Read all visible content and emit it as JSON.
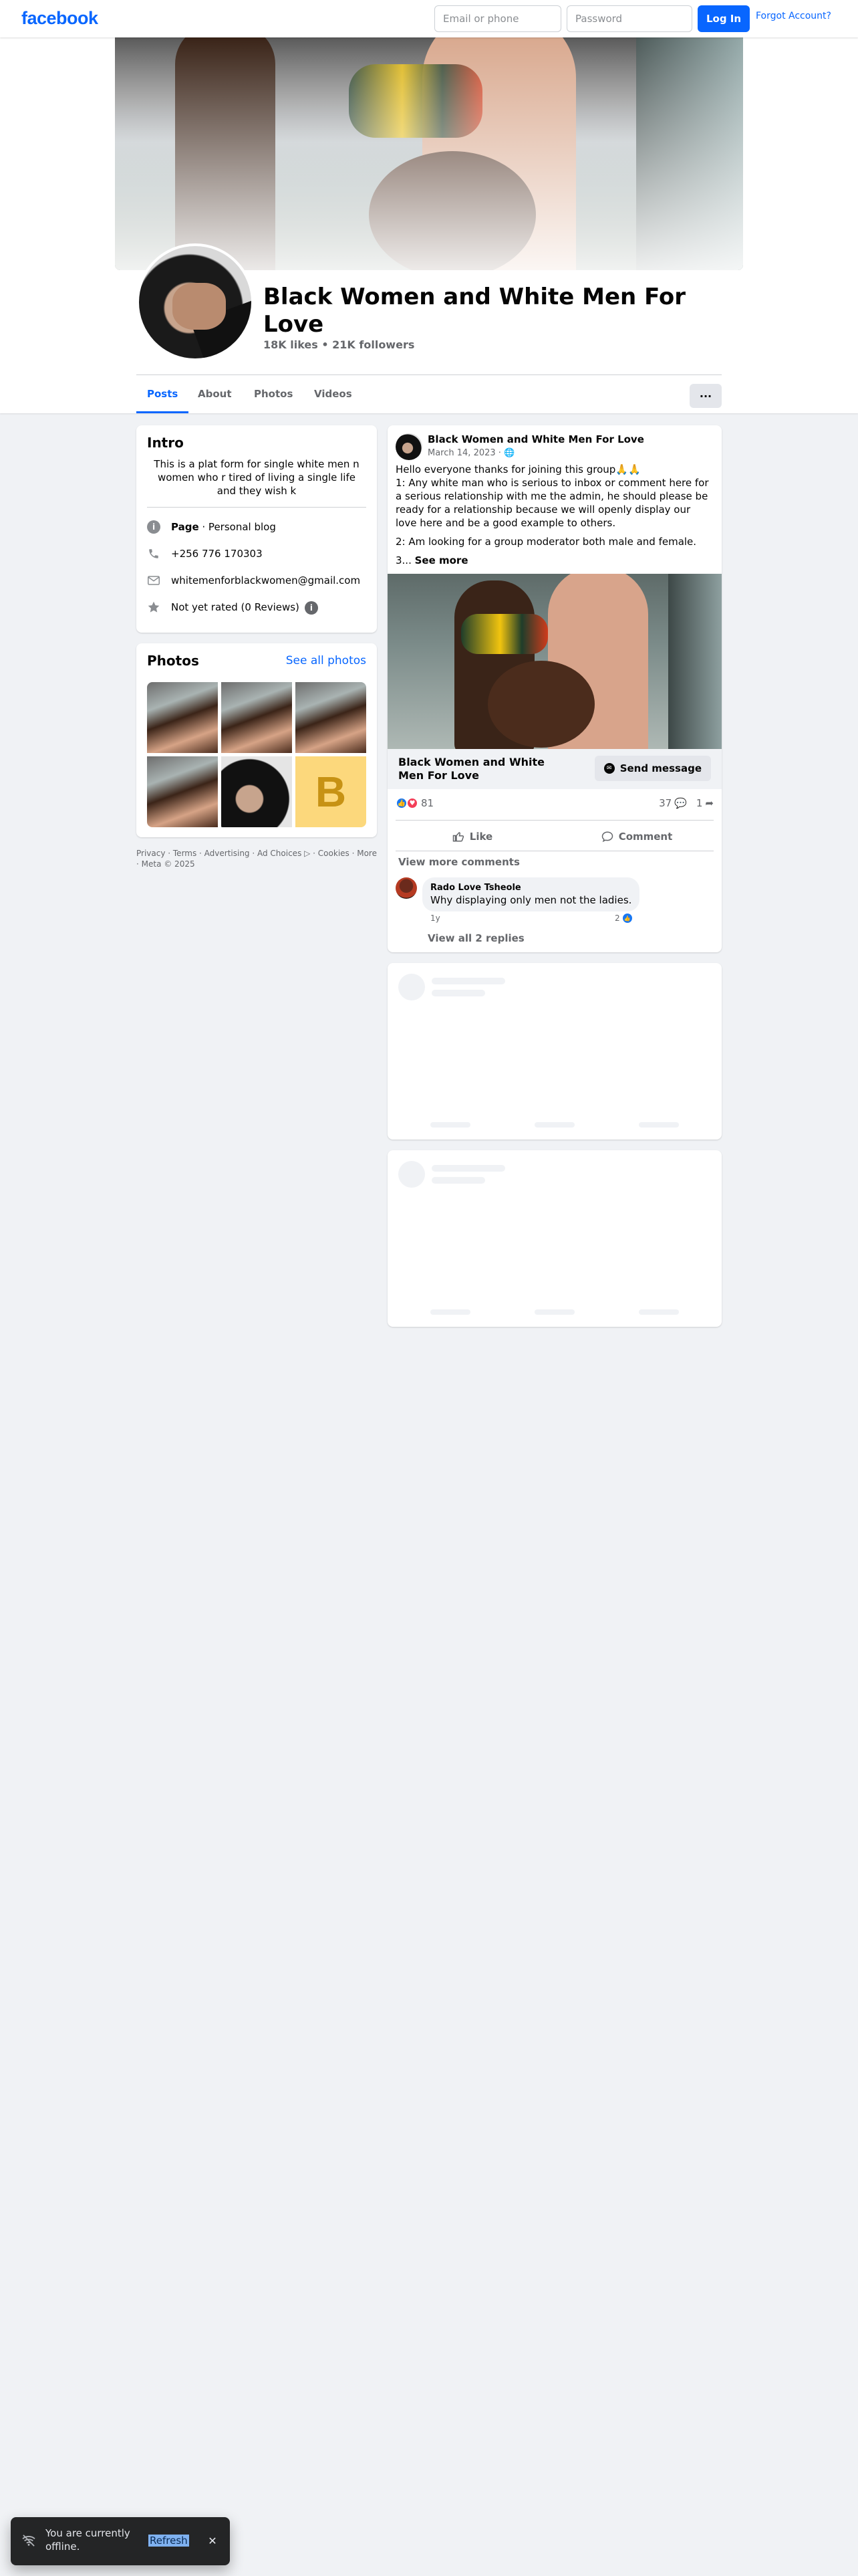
{
  "topbar": {
    "logo": "facebook",
    "email_placeholder": "Email or phone",
    "password_placeholder": "Password",
    "login_label": "Log In",
    "forgot_label": "Forgot Account?"
  },
  "header": {
    "page_name": "Black Women and White Men For Love",
    "stats": "18K likes • 21K followers",
    "tabs": [
      "Posts",
      "About",
      "Photos",
      "Videos"
    ],
    "more_label": "···"
  },
  "intro": {
    "title": "Intro",
    "bio": "This is a plat form for single white men n women who r tired of living a single life and they wish k",
    "page_label": "Page",
    "category": " · Personal blog",
    "phone": "+256 776 170303",
    "email": "whitemenforblackwomen@gmail.com",
    "rating": "Not yet rated (0 Reviews)"
  },
  "photos": {
    "title": "Photos",
    "see_all": "See all photos",
    "letter_tile": "B"
  },
  "footer": {
    "text": "Privacy · Terms · Advertising · Ad Choices ▷ · Cookies · More · Meta © 2025"
  },
  "post": {
    "author": "Black Women and White Men For Love",
    "date": "March 14, 2023 · 🌐",
    "line1": "Hello everyone thanks for joining this group🙏🙏",
    "line2": "1: Any white man who is serious to inbox or comment  here for a serious relationship with me the admin, he should please be ready for a relationship because we will openly display our love here and be a good example to others.",
    "line3": "2: Am looking for a group moderator both male and female.",
    "line4_prefix": "3... ",
    "see_more": "See more",
    "cta_name": "Black Women and White Men For Love",
    "cta_button": "Send message",
    "reaction_count": "81",
    "comment_count": "37",
    "share_count": "1",
    "like_label": "Like",
    "comment_label": "Comment",
    "view_more_comments": "View more comments",
    "comment": {
      "name": "Rado Love Tsheole",
      "text": "Why displaying only men not the ladies.",
      "time": "1y",
      "likes": "2"
    },
    "view_replies": "View all 2 replies"
  },
  "toast": {
    "text": "You are currently offline.",
    "link": "Refresh"
  },
  "colors": {
    "brand": "#0866ff",
    "background": "#f0f2f5",
    "secondary_text": "#65676b"
  }
}
